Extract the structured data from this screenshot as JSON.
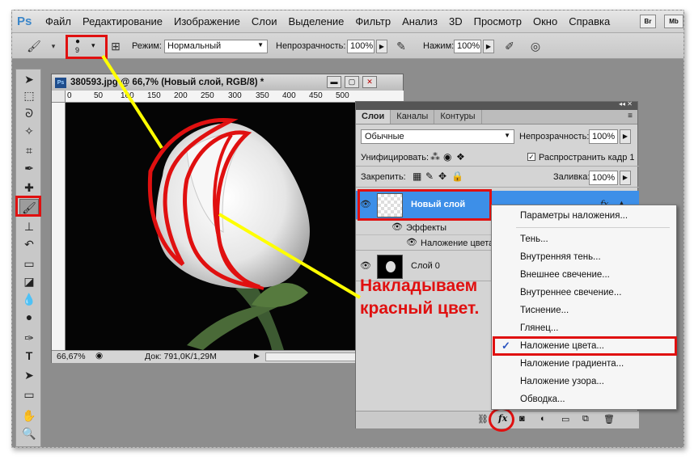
{
  "app": {
    "logo": "Ps",
    "bridge": "Br",
    "minibridge": "Mb"
  },
  "menu": [
    "Файл",
    "Редактирование",
    "Изображение",
    "Слои",
    "Выделение",
    "Фильтр",
    "Анализ",
    "3D",
    "Просмотр",
    "Окно",
    "Справка"
  ],
  "options": {
    "brush_size": "9",
    "mode_label": "Режим:",
    "mode_value": "Нормальный",
    "opacity_label": "Непрозрачность:",
    "opacity_value": "100%",
    "pressure_label": "Нажим:",
    "pressure_value": "100%"
  },
  "document": {
    "title": "380593.jpg @ 66,7% (Новый слой, RGB/8) *",
    "ruler_marks": [
      "0",
      "50",
      "100",
      "150",
      "200",
      "250",
      "300",
      "350",
      "400",
      "450",
      "500"
    ],
    "zoom": "66,67%",
    "doc_size": "Док: 791,0K/1,29M"
  },
  "layers_panel": {
    "tabs": [
      "Слои",
      "Каналы",
      "Контуры"
    ],
    "blend_mode": "Обычные",
    "opacity_label": "Непрозрачность:",
    "opacity_value": "100%",
    "unify_label": "Унифицировать:",
    "propagate_label": "Распространить кадр 1",
    "lock_label": "Закрепить:",
    "fill_label": "Заливка:",
    "fill_value": "100%",
    "layers": [
      {
        "name": "Новый слой",
        "fx": "fx"
      },
      {
        "name": "Эффекты"
      },
      {
        "name": "Наложение цвета"
      },
      {
        "name": "Слой 0"
      }
    ]
  },
  "context_menu": {
    "items": [
      "Параметры наложения...",
      "Тень...",
      "Внутренняя тень...",
      "Внешнее свечение...",
      "Внутреннее свечение...",
      "Тиснение...",
      "Глянец...",
      "Наложение цвета...",
      "Наложение градиента...",
      "Наложение узора...",
      "Обводка..."
    ],
    "selected_index": 7
  },
  "annotation": {
    "line1": "Накладываем",
    "line2": "красный цвет."
  },
  "colors": {
    "annotation_red": "#e01010",
    "selection_blue": "#3d8fe8",
    "pointer_yellow": "#ffff00"
  }
}
